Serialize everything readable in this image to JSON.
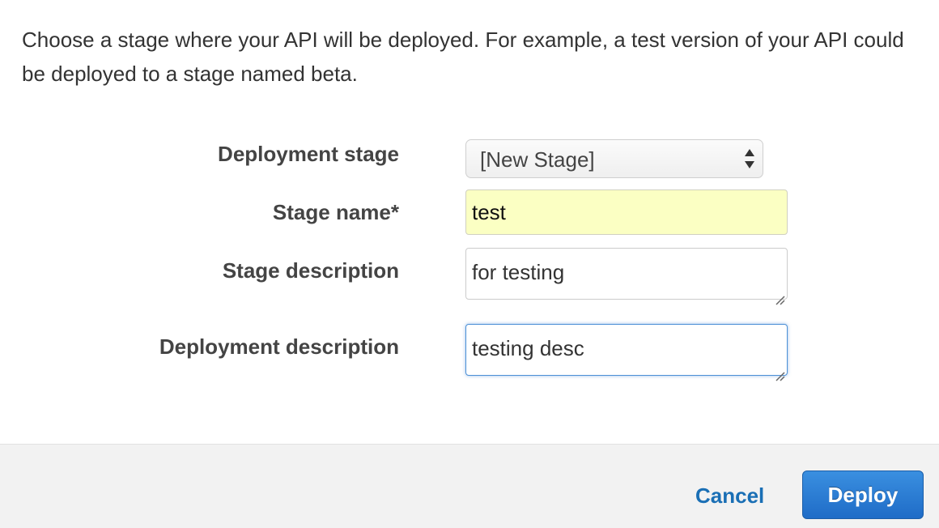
{
  "intro": {
    "text": "Choose a stage where your API will be deployed. For example, a test version of your API could be deployed to a stage named beta."
  },
  "form": {
    "deployment_stage": {
      "label": "Deployment stage",
      "selected": "[New Stage]"
    },
    "stage_name": {
      "label": "Stage name*",
      "value": "test"
    },
    "stage_description": {
      "label": "Stage description",
      "value": "for testing"
    },
    "deployment_description": {
      "label": "Deployment description",
      "value": "testing desc"
    }
  },
  "footer": {
    "cancel_label": "Cancel",
    "deploy_label": "Deploy"
  },
  "colors": {
    "primary": "#1f6cc7",
    "link": "#1a6fb5",
    "required_field_highlight": "#fbffc3",
    "focus_border": "#4d90d6",
    "footer_background": "#f2f2f2"
  },
  "icons": {
    "select_arrows": "up-down-arrows-icon",
    "resize_grip": "resize-grip-icon"
  }
}
